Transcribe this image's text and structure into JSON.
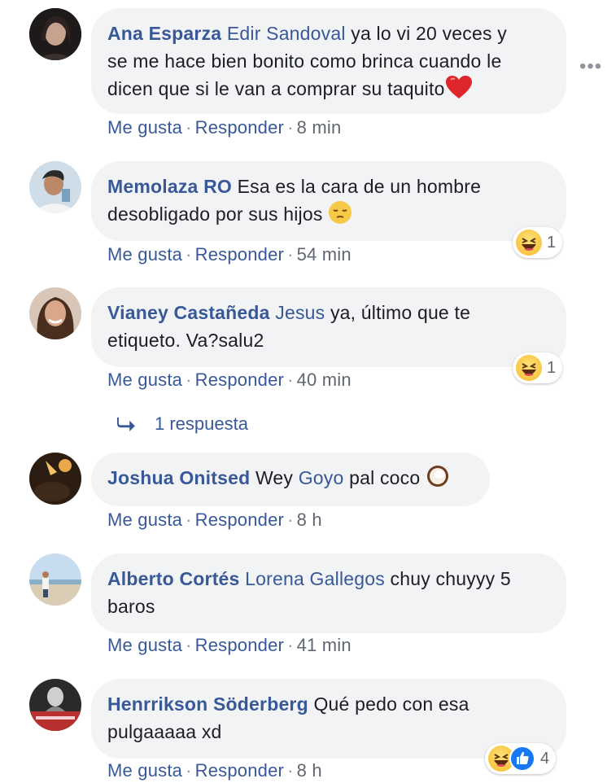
{
  "more_label": "•••",
  "reaction_colors": {
    "haha": "#f7b928",
    "like": "#1877f2"
  },
  "comments": [
    {
      "author": "Ana Esparza",
      "mention": "Edir Sandoval",
      "text_lines": [
        "ya lo vi 20 veces y",
        "se me hace bien bonito como brinca cuando le",
        "dicen que si le van a comprar su taquito"
      ],
      "trailing_emoji": "heart-icon",
      "like": "Me gusta",
      "reply": "Responder",
      "time": "8 min"
    },
    {
      "author": "Memolaza RO",
      "text_lines": [
        "Esa es la cara de un hombre",
        "desobligado por sus hijos"
      ],
      "trailing_emoji": "pensive-face-icon",
      "like": "Me gusta",
      "reply": "Responder",
      "time": "54 min",
      "reactions": {
        "types": [
          "haha"
        ],
        "count": "1"
      }
    },
    {
      "author": "Vianey Castañeda",
      "mention": "Jesus",
      "text_lines": [
        "ya, último que te",
        "etiqueto. Va?salu2"
      ],
      "like": "Me gusta",
      "reply": "Responder",
      "time": "40 min",
      "reactions": {
        "types": [
          "haha"
        ],
        "count": "1"
      },
      "replies_label": "1 respuesta"
    },
    {
      "author": "Joshua Onitsed",
      "pre_text": "Wey",
      "mention": "Goyo",
      "text_lines": [
        "pal coco"
      ],
      "trailing_emoji": "coconut-icon",
      "like": "Me gusta",
      "reply": "Responder",
      "time": "8 h"
    },
    {
      "author": "Alberto Cortés",
      "mention": "Lorena Gallegos",
      "text_lines": [
        "chuy chuyyy 5",
        "baros"
      ],
      "like": "Me gusta",
      "reply": "Responder",
      "time": "41 min"
    },
    {
      "author": "Henrrikson Söderberg",
      "text_lines": [
        "Qué pedo con esa",
        "pulgaaaaa xd"
      ],
      "like": "Me gusta",
      "reply": "Responder",
      "time": "8 h",
      "reactions": {
        "types": [
          "haha",
          "like"
        ],
        "count": "4"
      }
    }
  ]
}
